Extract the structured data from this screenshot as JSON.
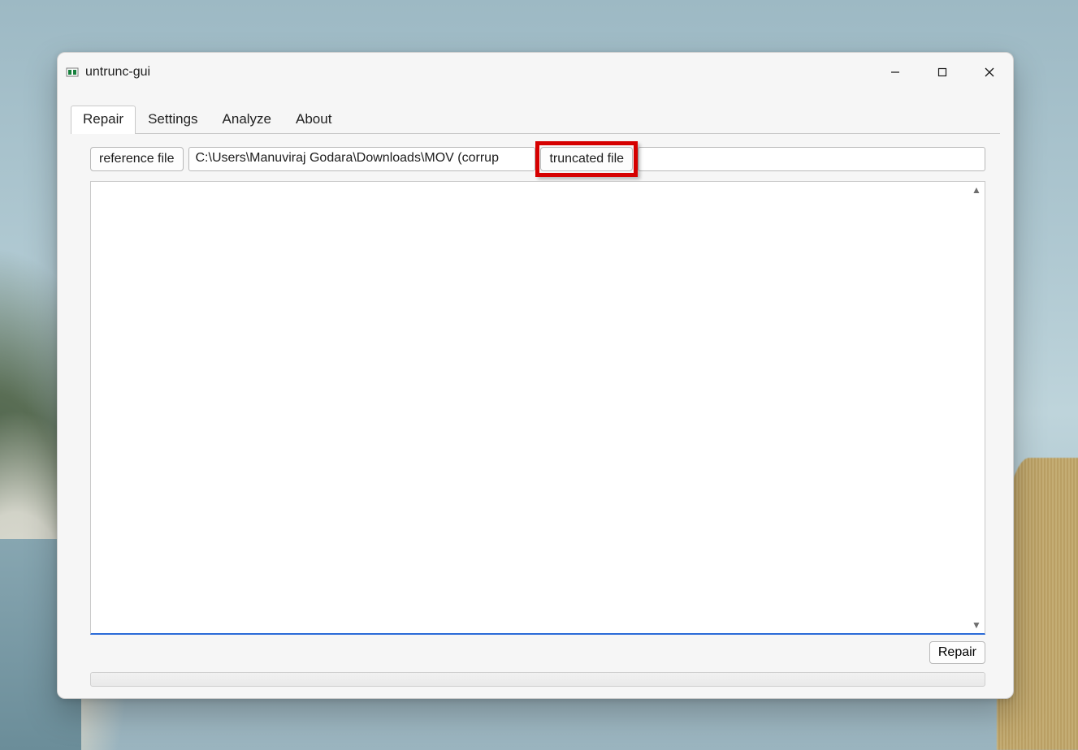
{
  "window": {
    "title": "untrunc-gui"
  },
  "tabs": {
    "items": [
      "Repair",
      "Settings",
      "Analyze",
      "About"
    ],
    "active_index": 0
  },
  "repair": {
    "reference_button_label": "reference file",
    "reference_value": "C:\\Users\\Manuviraj Godara\\Downloads\\MOV (corrup",
    "truncated_button_label": "truncated file",
    "truncated_value": "",
    "log_text": "",
    "action_button_label": "Repair"
  },
  "highlight": {
    "target": "truncated_button",
    "color": "#d60000"
  }
}
